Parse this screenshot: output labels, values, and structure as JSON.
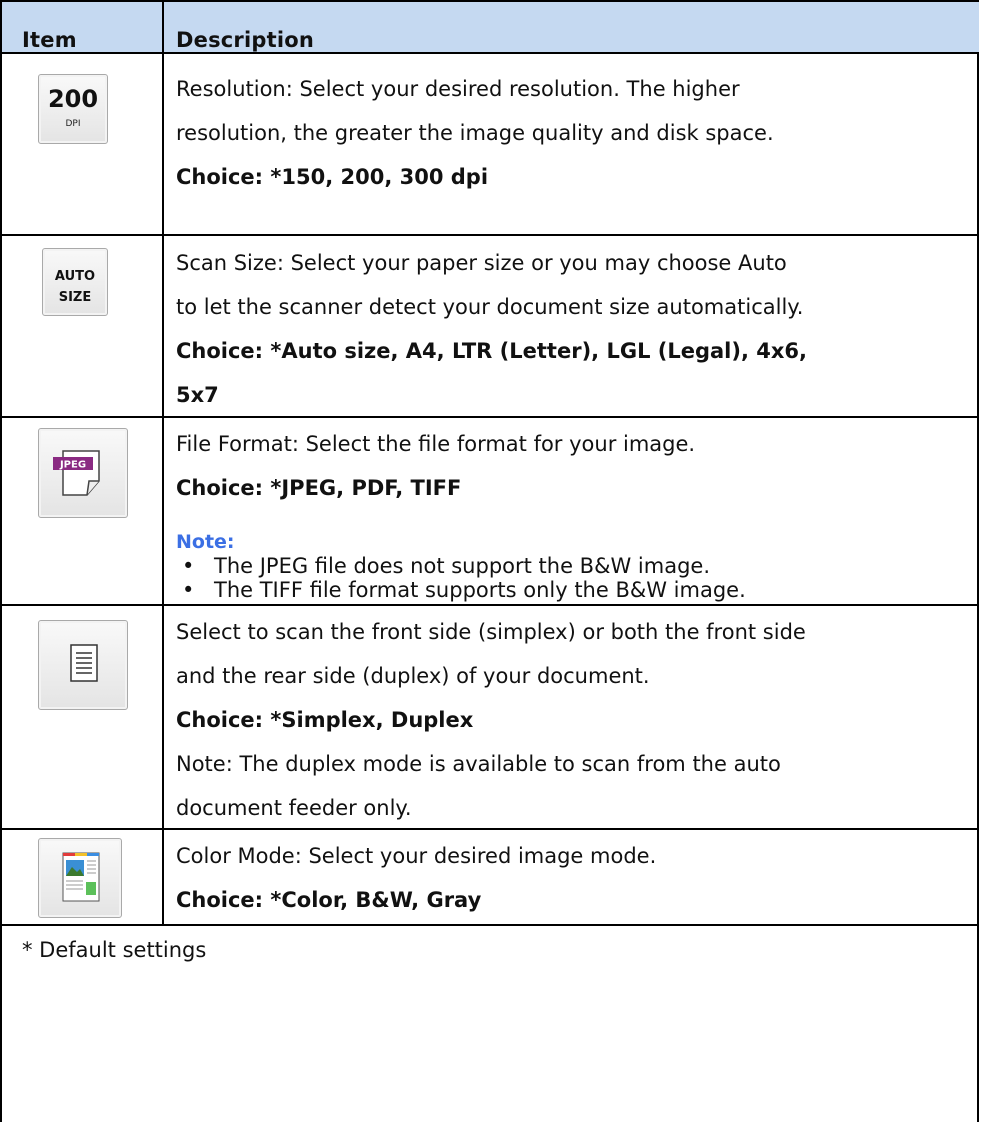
{
  "header": {
    "item": "Item",
    "description": "Description"
  },
  "rows": [
    {
      "icon": "dpi-200-icon",
      "icon_number": "200",
      "icon_caption": "DPI",
      "lines": [
        "Resolution: Select your desired resolution. The higher",
        "resolution, the greater the image quality and disk space."
      ],
      "choice": "Choice: *150, 200, 300 dpi"
    },
    {
      "icon": "auto-size-icon",
      "icon_line1": "AUTO",
      "icon_line2": "SIZE",
      "lines": [
        "Scan Size: Select your paper size or you may choose Auto",
        "to let the scanner detect your document size automatically."
      ],
      "choice_lines": [
        "Choice: *Auto size, A4, LTR (Letter), LGL (Legal), 4x6,",
        "5x7"
      ]
    },
    {
      "icon": "jpeg-file-icon",
      "icon_label": "JPEG",
      "lines": [
        "File Format: Select the file format for your image."
      ],
      "choice": "Choice: *JPEG, PDF, TIFF",
      "note_title": "Note:",
      "notes": [
        "The JPEG file does not support the B&W image.",
        "The TIFF file format supports only the B&W image."
      ]
    },
    {
      "icon": "simplex-document-icon",
      "lines": [
        "Select to scan the front side (simplex) or both the front side",
        "and the rear side (duplex) of your document."
      ],
      "choice": "Choice: *Simplex, Duplex",
      "note_lines": [
        "Note: The duplex mode is available to scan from the auto",
        "document feeder only."
      ]
    },
    {
      "icon": "color-mode-icon",
      "lines": [
        "Color Mode: Select your desired image mode."
      ],
      "choice": "Choice: *Color, B&W, Gray"
    }
  ],
  "footer": "* Default settings",
  "colors": {
    "header_bg": "#c5d9f1",
    "note_blue": "#3b6fe4",
    "border": "#000000"
  }
}
